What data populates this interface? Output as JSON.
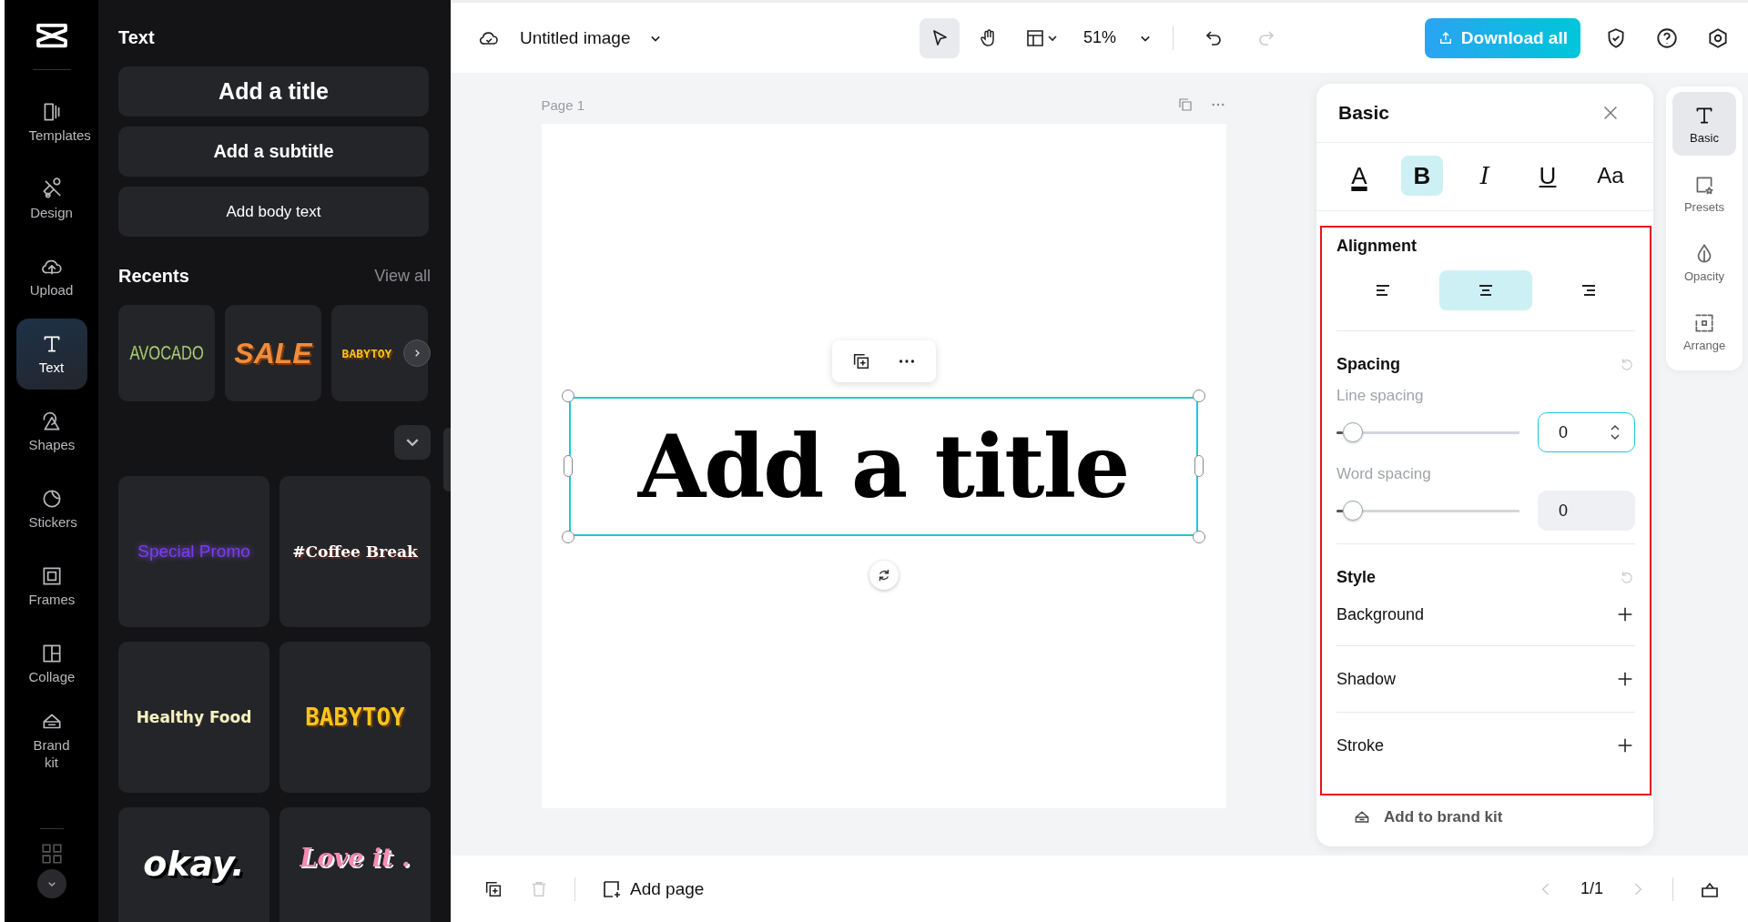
{
  "rail": {
    "items": [
      {
        "label": "Templates",
        "selected": false
      },
      {
        "label": "Design",
        "selected": false
      },
      {
        "label": "Upload",
        "selected": false
      },
      {
        "label": "Text",
        "selected": true
      },
      {
        "label": "Shapes",
        "selected": false
      },
      {
        "label": "Stickers",
        "selected": false
      },
      {
        "label": "Frames",
        "selected": false
      },
      {
        "label": "Collage",
        "selected": false
      },
      {
        "label": "Brand kit",
        "selected": false
      }
    ]
  },
  "text_panel": {
    "title": "Text",
    "add_buttons": [
      {
        "label": "Add a title",
        "kind": "title"
      },
      {
        "label": "Add a subtitle",
        "kind": "subtitle"
      },
      {
        "label": "Add body text",
        "kind": "body"
      }
    ],
    "recents_heading": "Recents",
    "view_all": "View all",
    "recents": [
      {
        "text": "AVOCADO",
        "kind": "condensed",
        "color": "#c3e08f"
      },
      {
        "text": "SALE",
        "kind": "heavy",
        "color": "#f08c3c"
      },
      {
        "text": "BABYTOY",
        "kind": "block",
        "color": "#f5c518"
      }
    ],
    "styles": [
      {
        "text": "Special Promo",
        "kind": "glow",
        "color": "#7b3cf0"
      },
      {
        "text": "#Coffee Break",
        "kind": "serif",
        "color": "#ffffff"
      },
      {
        "text": "Healthy Food",
        "kind": "rounded",
        "color": "#f6f1c2"
      },
      {
        "text": "BABYTOY",
        "kind": "block",
        "color": "#f7c51b"
      },
      {
        "text": "okay.",
        "kind": "shadow",
        "color": "#ffffff"
      },
      {
        "text": "Love it .",
        "kind": "serif",
        "color": "#f58bb3"
      }
    ]
  },
  "top_bar": {
    "document_title": "Untitled image",
    "zoom": "51%",
    "download": "Download all"
  },
  "canvas": {
    "page_label": "Page 1",
    "text": "Add a title"
  },
  "properties": {
    "title": "Basic",
    "format": [
      {
        "label": "A",
        "kind": "color",
        "selected": false
      },
      {
        "label": "B",
        "kind": "bold",
        "selected": true
      },
      {
        "label": "I",
        "kind": "italic",
        "selected": false
      },
      {
        "label": "U",
        "kind": "underline",
        "selected": false
      },
      {
        "label": "Aa",
        "kind": "case",
        "selected": false
      }
    ],
    "alignment": {
      "heading": "Alignment",
      "options": [
        {
          "kind": "left",
          "selected": false
        },
        {
          "kind": "center",
          "selected": true
        },
        {
          "kind": "right",
          "selected": false
        }
      ]
    },
    "spacing": {
      "heading": "Spacing",
      "sliders": [
        {
          "label": "Line spacing",
          "level": 0.09,
          "value": "0",
          "focused": true
        },
        {
          "label": "Word spacing",
          "level": 0.09,
          "value": "0",
          "focused": false
        }
      ]
    },
    "style": {
      "heading": "Style",
      "rows": [
        "Background",
        "Shadow",
        "Stroke"
      ]
    },
    "brand_kit": "Add to brand kit"
  },
  "side_tabs": [
    {
      "label": "Basic",
      "selected": true
    },
    {
      "label": "Presets",
      "selected": false
    },
    {
      "label": "Opacity",
      "selected": false
    },
    {
      "label": "Arrange",
      "selected": false
    }
  ],
  "bottom_bar": {
    "add_page": "Add page",
    "page_count": "1/1"
  }
}
